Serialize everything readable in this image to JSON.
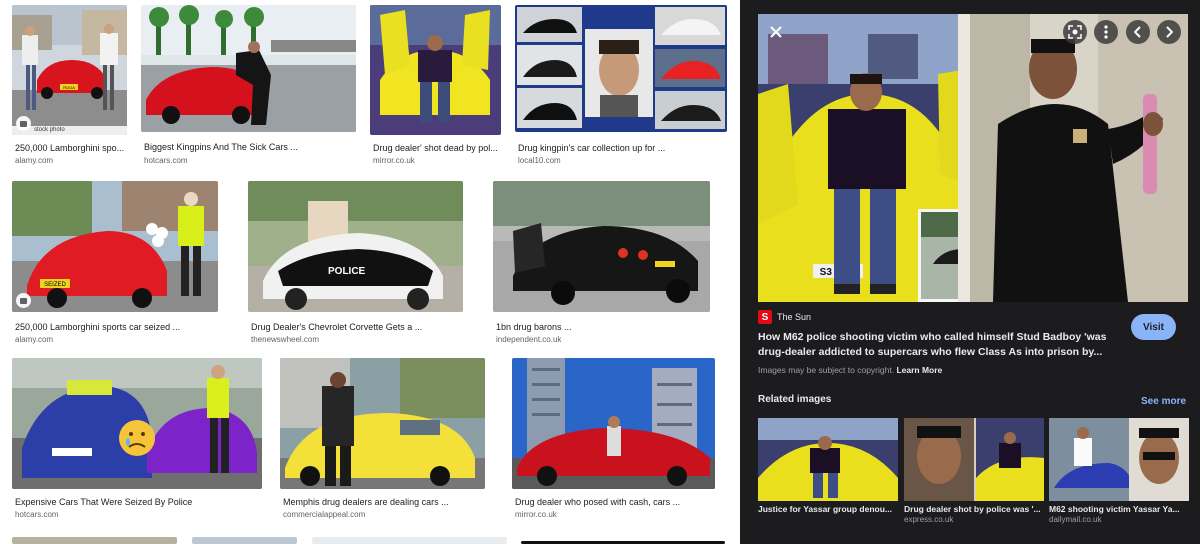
{
  "grid": {
    "tiles": [
      {
        "title": "250,000 Lamborghini spo...",
        "source": "alamy.com",
        "badge_text": "stock photo"
      },
      {
        "title": "Biggest Kingpins And The Sick Cars ...",
        "source": "hotcars.com"
      },
      {
        "title": "Drug dealer' shot dead by pol...",
        "source": "mirror.co.uk"
      },
      {
        "title": "Drug kingpin's car collection up for ...",
        "source": "local10.com"
      },
      {
        "title": "250,000 Lamborghini sports car seized ...",
        "source": "alamy.com"
      },
      {
        "title": "Drug Dealer's Chevrolet Corvette Gets a ...",
        "source": "thenewswheel.com"
      },
      {
        "title": "1bn drug barons ...",
        "source": "independent.co.uk"
      },
      {
        "title": "Expensive Cars That Were Seized By Police",
        "source": "hotcars.com"
      },
      {
        "title": "Memphis drug dealers are dealing cars ...",
        "source": "commercialappeal.com"
      },
      {
        "title": "Drug dealer who posed with cash, cars ...",
        "source": "mirror.co.uk"
      }
    ],
    "plate_texts": {
      "ferrari_plate": "ROGA",
      "lambo_plate": "SEIZED",
      "police_car": "POLICE",
      "preview_plate": "S3 UPO"
    }
  },
  "panel": {
    "source_logo": "S",
    "source_name": "The Sun",
    "visit_label": "Visit",
    "title": "How M62 police shooting victim who called himself Stud Badboy 'was drug-dealer addicted to supercars who flew Class As into prison by...",
    "copyright_text": "Images may be subject to copyright.",
    "learn_more": "Learn More",
    "related_heading": "Related images",
    "see_more": "See more",
    "related": [
      {
        "title": "Justice for Yassar group denou...",
        "source": ""
      },
      {
        "title": "Drug dealer shot by police was '...",
        "source": "express.co.uk"
      },
      {
        "title": "M62 shooting victim Yassar Ya...",
        "source": "dailymail.co.uk"
      }
    ],
    "controls": {
      "close": "close-icon",
      "lens": "lens-icon",
      "more": "more-vert-icon",
      "prev": "chevron-left-icon",
      "next": "chevron-right-icon"
    }
  },
  "colors": {
    "panel_bg": "#1c1c1e",
    "visit_bg": "#8ab4f8",
    "link": "#8ab4f8",
    "sun_red": "#e50914"
  }
}
